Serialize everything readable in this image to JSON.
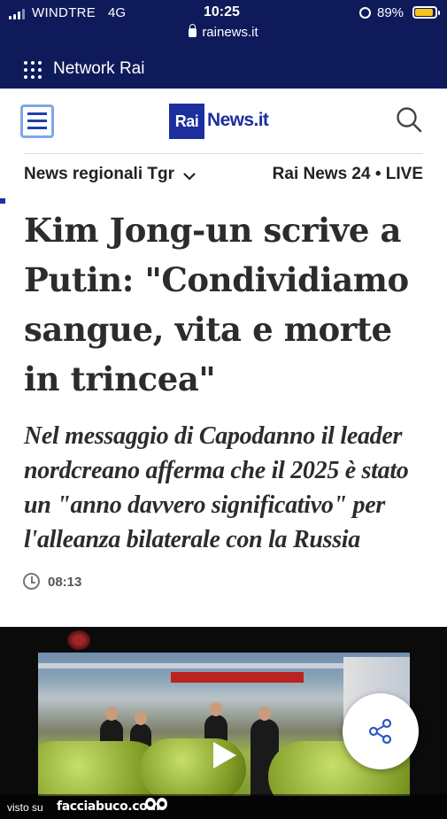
{
  "status_bar": {
    "carrier": "WINDTRE",
    "network": "4G",
    "time": "10:25",
    "battery_pct": "89%",
    "battery_level": 0.89,
    "url": "rainews.it"
  },
  "network_bar": {
    "label": "Network Rai",
    "icon": "grid-dots-icon"
  },
  "header": {
    "logo_rai": "Rai",
    "logo_news": "News.it",
    "brand_color": "#1d2f9e",
    "regional_label": "News regionali Tgr",
    "live_label": "Rai News 24 • LIVE"
  },
  "article": {
    "title": "Kim Jong-un scrive a Putin: \"Condividiamo sangue, vita e morte in trincea\"",
    "subtitle": "Nel messaggio di Capodanno il leader nordcreano afferma che il 2025 è stato un \"anno davvero significativo\" per l'alleanza bilaterale con la Russia",
    "time": "08:13"
  },
  "watermark": {
    "prefix": "visto su",
    "site": "facciabuco.com"
  }
}
